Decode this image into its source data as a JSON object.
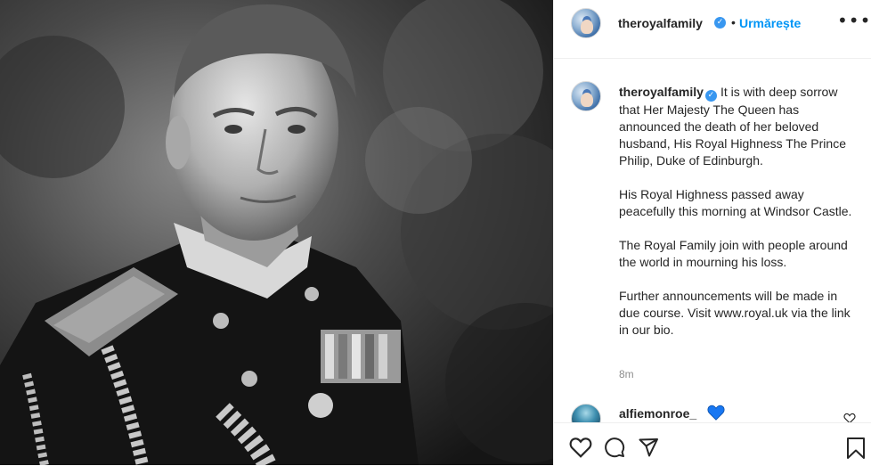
{
  "post": {
    "author": {
      "username": "theroyalfamily",
      "verified": true,
      "follow_label": "Urmărește",
      "separator": "•"
    },
    "more_label": "•••",
    "caption": {
      "username": "theroyalfamily",
      "paragraphs": [
        "It is with deep sorrow that Her Majesty The Queen has announced the death of her beloved husband, His Royal Highness The Prince Philip, Duke of Edinburgh.",
        "His Royal Highness passed away peacefully this morning at Windsor Castle.",
        "The Royal Family join with people around the world in mourning his loss.",
        "Further announcements will be made in due course. Visit www.royal.uk via the link in our bio."
      ],
      "time": "8m"
    },
    "comments": [
      {
        "username": "alfiemonroe_",
        "emoji": "blue-heart-icon",
        "emoji_color": "#1877f2"
      }
    ],
    "actions": {
      "like_icon": "heart-outline-icon",
      "comment_icon": "comment-bubble-icon",
      "share_icon": "paper-plane-icon",
      "save_icon": "bookmark-icon"
    },
    "colors": {
      "accent": "#0095f6",
      "verified": "#3897f0",
      "text": "#262626",
      "muted": "#8e8e8e"
    }
  }
}
